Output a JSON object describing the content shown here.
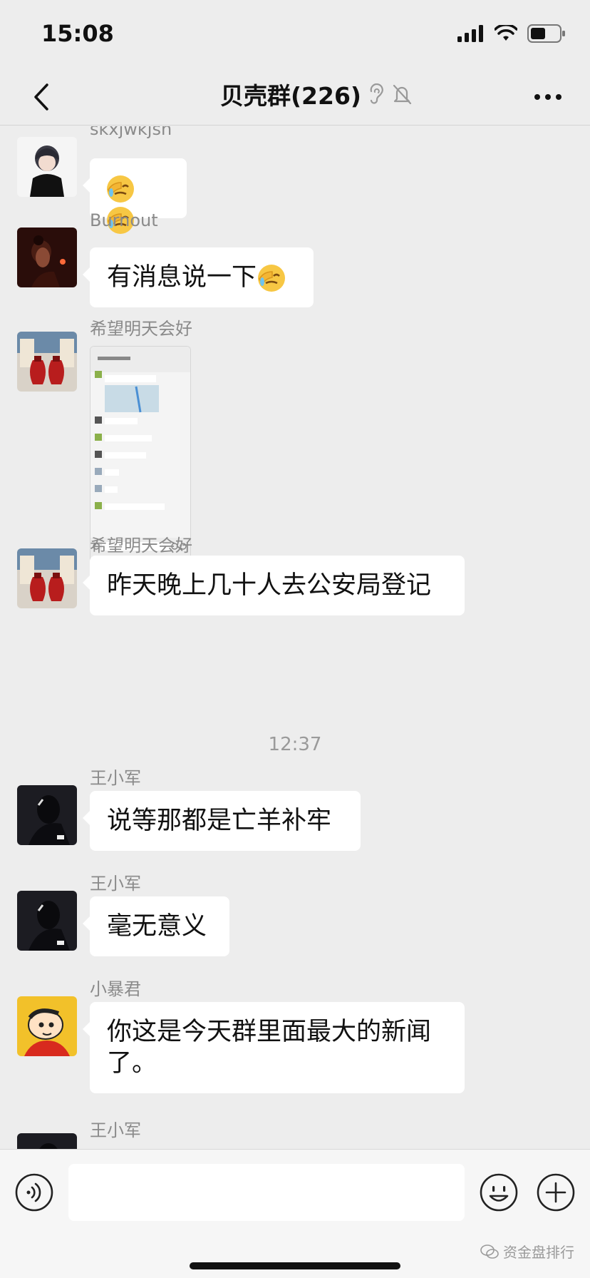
{
  "status_bar": {
    "time": "15:08",
    "battery_icon": "battery-icon",
    "wifi_icon": "wifi-icon",
    "signal_icon": "signal-icon"
  },
  "nav": {
    "back_icon": "chevron-left-icon",
    "title": "贝壳群(226)",
    "ear_icon": "ear-icon",
    "mute_icon": "bell-muted-icon",
    "more_icon": "more-dots-icon"
  },
  "messages": [
    {
      "sender": "skxjwkjsn",
      "text": "",
      "emojis": [
        "facepalm-emoji",
        "facepalm-emoji"
      ]
    },
    {
      "sender": "Burnout",
      "text": "有消息说一下",
      "emojis": [
        "facepalm-emoji"
      ]
    },
    {
      "sender": "希望明天会好",
      "image": "chat-screenshot-image"
    },
    {
      "sender": "希望明天会好",
      "text": "昨天晚上几十人去公安局登记"
    },
    {
      "sender": "王小军",
      "text": "说等那都是亡羊补牢"
    },
    {
      "sender": "王小军",
      "text": "毫无意义"
    },
    {
      "sender": "小暴君",
      "text_line1": "你这是今天群里面最大的新闻",
      "text_line2": "了。"
    },
    {
      "sender": "王小军"
    }
  ],
  "timestamp": "12:37",
  "input": {
    "placeholder": "",
    "voice_icon": "voice-icon",
    "emoji_icon": "smiley-icon",
    "plus_icon": "plus-icon"
  },
  "watermark": {
    "text": "资金盘排行",
    "icon": "wechat-icon"
  },
  "colors": {
    "background": "#ededed",
    "bubble": "#ffffff",
    "sender": "#8a8a8a"
  }
}
